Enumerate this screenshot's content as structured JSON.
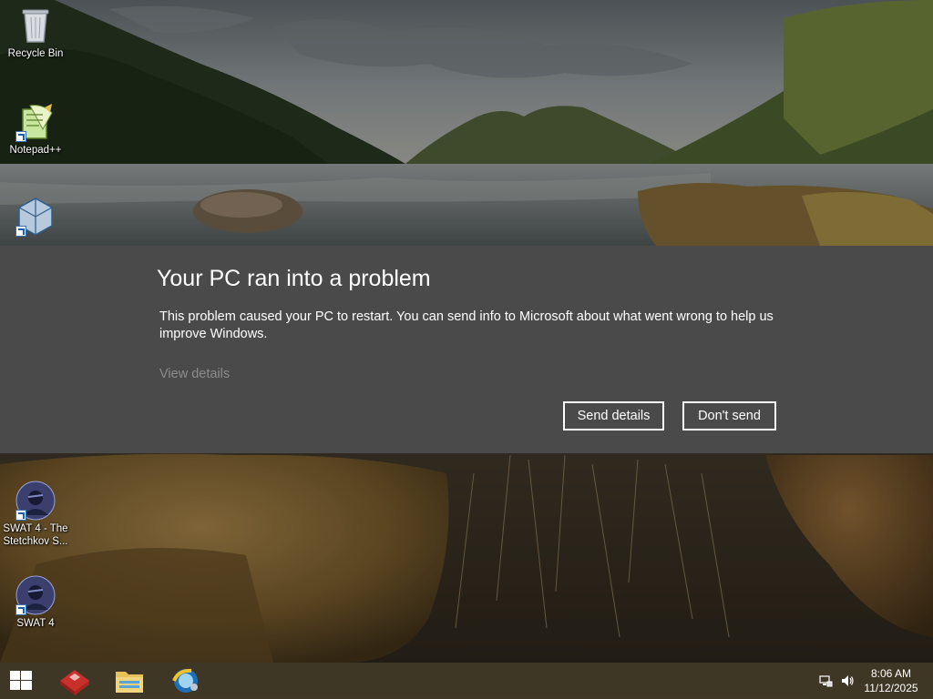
{
  "desktop": {
    "icons": [
      {
        "label": "Recycle Bin"
      },
      {
        "label": "Notepad++"
      },
      {
        "label": ""
      },
      {
        "label": "SWAT 4 - The Stetchkov S..."
      },
      {
        "label": "SWAT 4"
      }
    ]
  },
  "dialog": {
    "title": "Your PC ran into a problem",
    "body": "This problem caused your PC to restart. You can send info to Microsoft about what went wrong to help us improve Windows.",
    "view_details": "View details",
    "send_label": "Send details",
    "dont_send_label": "Don't send"
  },
  "taskbar": {
    "start_icon": "windows-logo-icon",
    "pinned_icons": [
      "app-launcher-icon",
      "file-explorer-icon",
      "browser-icon"
    ],
    "tray_icons": [
      "network-icon",
      "volume-icon"
    ],
    "clock": {
      "time": "8:06 AM",
      "date": "11/12/2025"
    }
  },
  "colors": {
    "dialog_bg": "#4a4a4a",
    "dialog_text": "#ffffff",
    "link_muted": "#8c8c8c",
    "taskbar_bg": "#463c28"
  }
}
